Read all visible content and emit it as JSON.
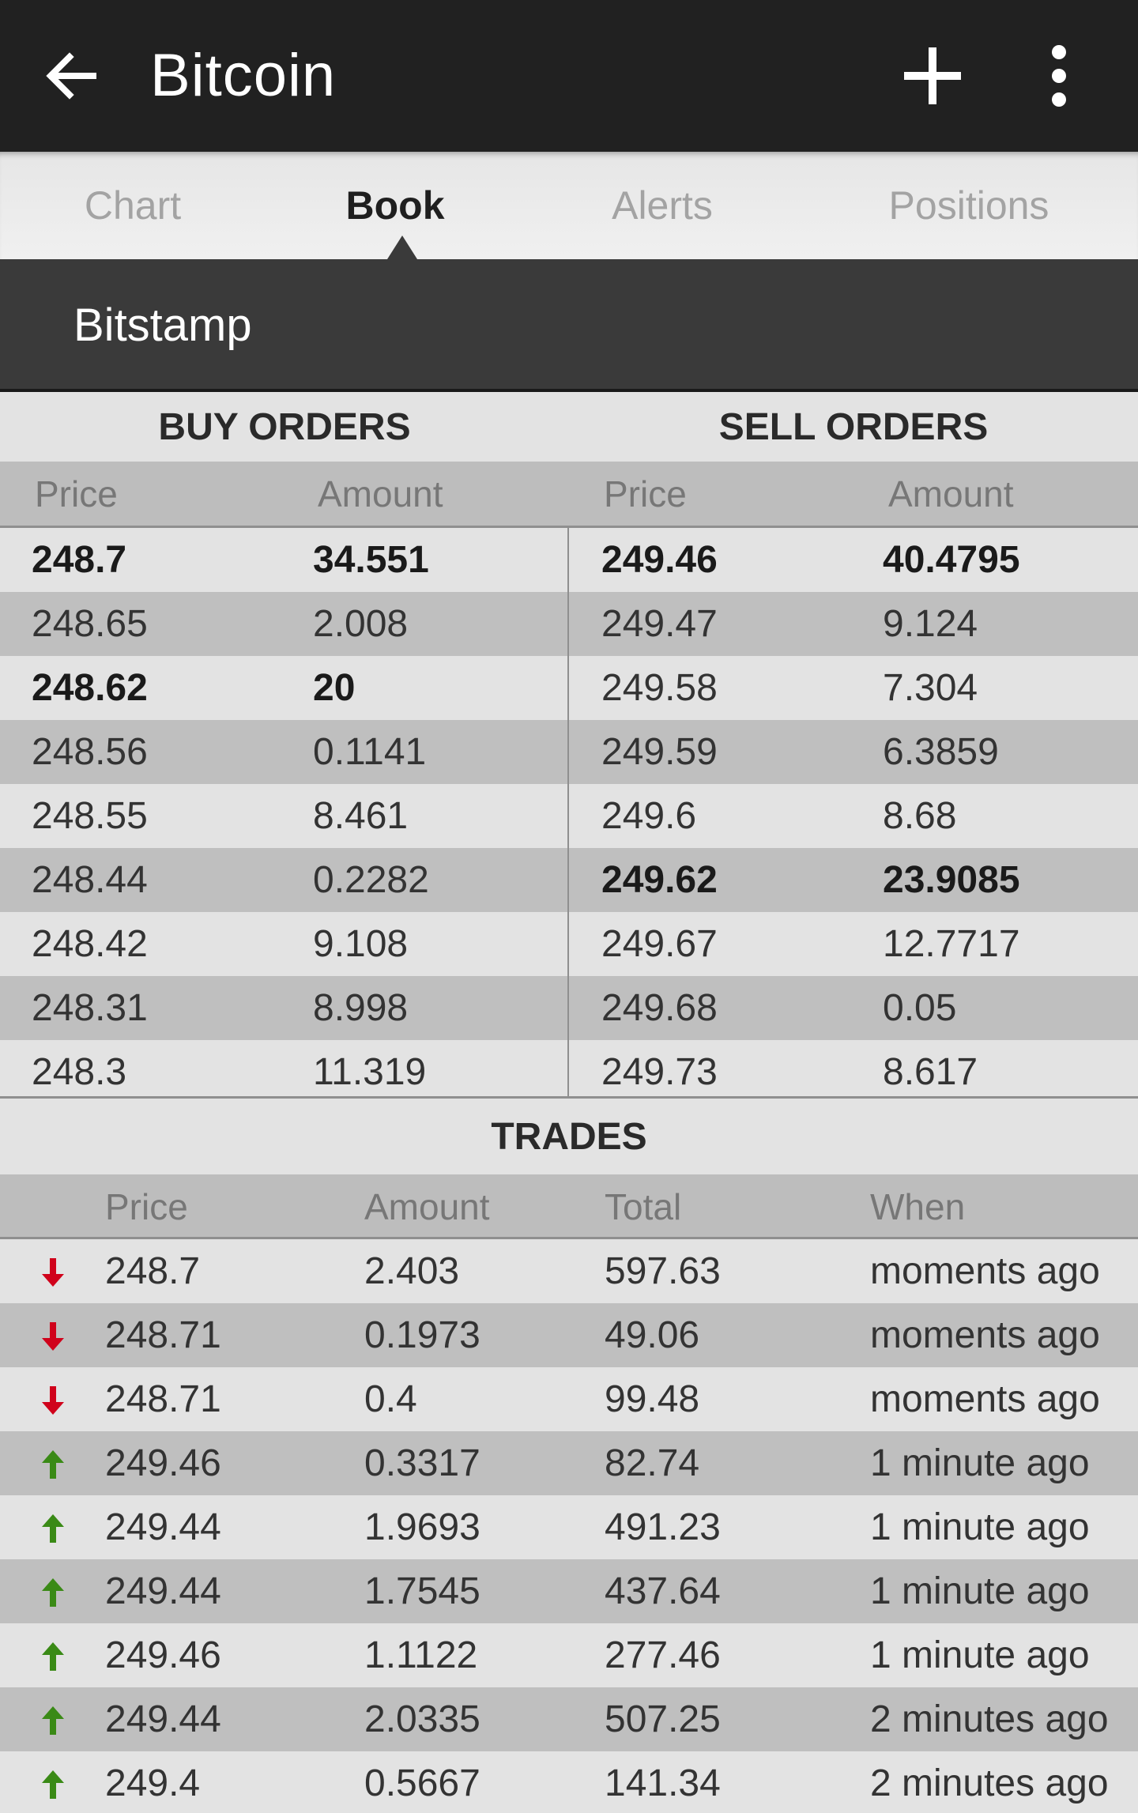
{
  "appbar": {
    "title": "Bitcoin",
    "back_icon": "arrow-left-icon",
    "add_icon": "plus-icon",
    "more_icon": "more-vertical-icon"
  },
  "tabs": [
    {
      "label": "Chart",
      "active": false
    },
    {
      "label": "Book",
      "active": true
    },
    {
      "label": "Alerts",
      "active": false
    },
    {
      "label": "Positions",
      "active": false
    }
  ],
  "exchange": {
    "name": "Bitstamp"
  },
  "orderbook": {
    "buy_title": "BUY ORDERS",
    "sell_title": "SELL ORDERS",
    "price_label": "Price",
    "amount_label": "Amount",
    "rows": [
      {
        "buy_price": "248.7",
        "buy_amount": "34.551",
        "buy_bold": true,
        "sell_price": "249.46",
        "sell_amount": "40.4795",
        "sell_bold": true
      },
      {
        "buy_price": "248.65",
        "buy_amount": "2.008",
        "buy_bold": false,
        "sell_price": "249.47",
        "sell_amount": "9.124",
        "sell_bold": false
      },
      {
        "buy_price": "248.62",
        "buy_amount": "20",
        "buy_bold": true,
        "sell_price": "249.58",
        "sell_amount": "7.304",
        "sell_bold": false
      },
      {
        "buy_price": "248.56",
        "buy_amount": "0.1141",
        "buy_bold": false,
        "sell_price": "249.59",
        "sell_amount": "6.3859",
        "sell_bold": false
      },
      {
        "buy_price": "248.55",
        "buy_amount": "8.461",
        "buy_bold": false,
        "sell_price": "249.6",
        "sell_amount": "8.68",
        "sell_bold": false
      },
      {
        "buy_price": "248.44",
        "buy_amount": "0.2282",
        "buy_bold": false,
        "sell_price": "249.62",
        "sell_amount": "23.9085",
        "sell_bold": true
      },
      {
        "buy_price": "248.42",
        "buy_amount": "9.108",
        "buy_bold": false,
        "sell_price": "249.67",
        "sell_amount": "12.7717",
        "sell_bold": false
      },
      {
        "buy_price": "248.31",
        "buy_amount": "8.998",
        "buy_bold": false,
        "sell_price": "249.68",
        "sell_amount": "0.05",
        "sell_bold": false
      },
      {
        "buy_price": "248.3",
        "buy_amount": "11.319",
        "buy_bold": false,
        "sell_price": "249.73",
        "sell_amount": "8.617",
        "sell_bold": false
      }
    ]
  },
  "trades": {
    "title": "TRADES",
    "headers": {
      "price": "Price",
      "amount": "Amount",
      "total": "Total",
      "when": "When"
    },
    "colors": {
      "down": "#d0021b",
      "up": "#3a8a16"
    },
    "rows": [
      {
        "direction": "down",
        "price": "248.7",
        "amount": "2.403",
        "total": "597.63",
        "when": "moments ago"
      },
      {
        "direction": "down",
        "price": "248.71",
        "amount": "0.1973",
        "total": "49.06",
        "when": "moments ago"
      },
      {
        "direction": "down",
        "price": "248.71",
        "amount": "0.4",
        "total": "99.48",
        "when": "moments ago"
      },
      {
        "direction": "up",
        "price": "249.46",
        "amount": "0.3317",
        "total": "82.74",
        "when": "1 minute ago"
      },
      {
        "direction": "up",
        "price": "249.44",
        "amount": "1.9693",
        "total": "491.23",
        "when": "1 minute ago"
      },
      {
        "direction": "up",
        "price": "249.44",
        "amount": "1.7545",
        "total": "437.64",
        "when": "1 minute ago"
      },
      {
        "direction": "up",
        "price": "249.46",
        "amount": "1.1122",
        "total": "277.46",
        "when": "1 minute ago"
      },
      {
        "direction": "up",
        "price": "249.44",
        "amount": "2.0335",
        "total": "507.25",
        "when": "2 minutes ago"
      },
      {
        "direction": "up",
        "price": "249.4",
        "amount": "0.5667",
        "total": "141.34",
        "when": "2 minutes ago"
      }
    ]
  }
}
